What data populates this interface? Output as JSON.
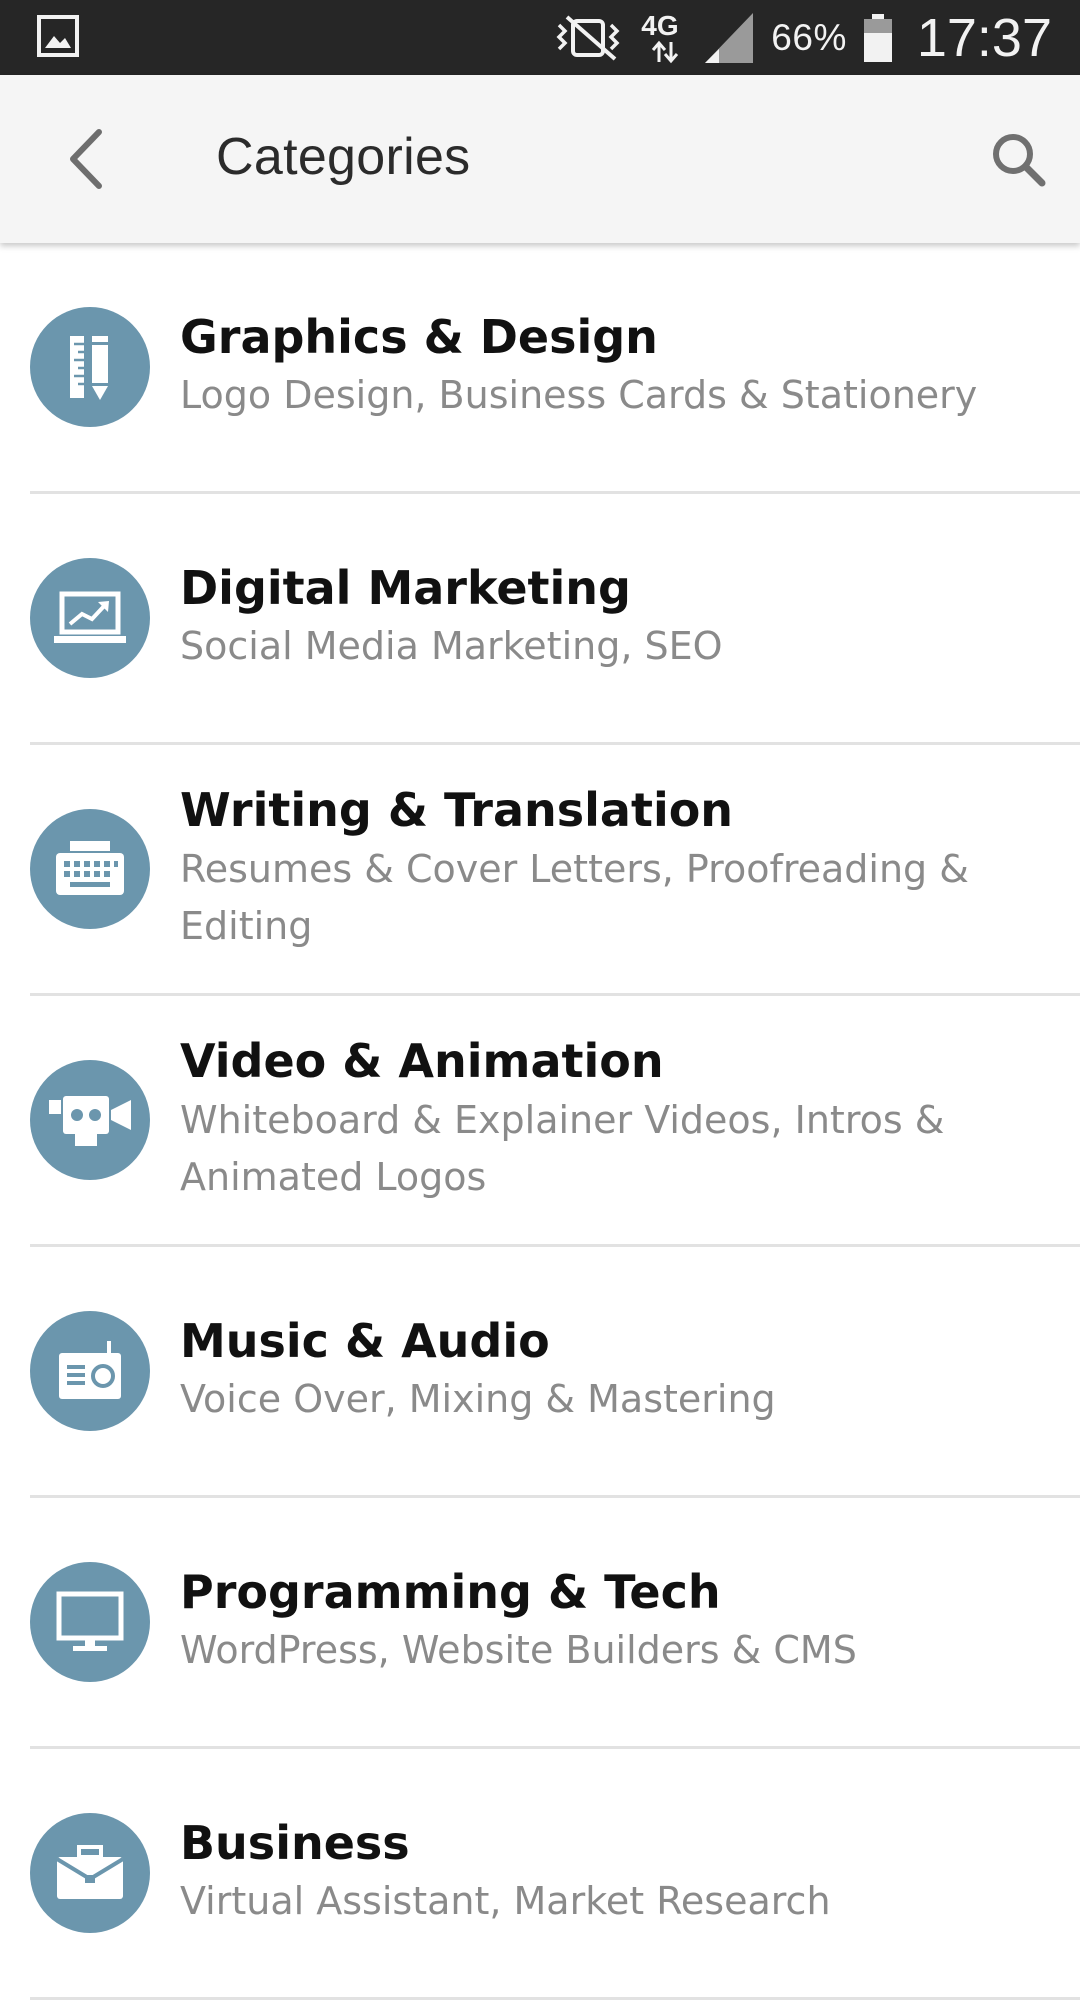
{
  "status_bar": {
    "network": "4G",
    "battery_percent": "66%",
    "time": "17:37",
    "icons": [
      "image-icon",
      "vibrate-off-icon",
      "network-4g-icon",
      "signal-icon",
      "battery-icon"
    ]
  },
  "app_bar": {
    "title": "Categories",
    "back_icon": "chevron-left-icon",
    "search_icon": "search-icon"
  },
  "colors": {
    "icon_circle": "#6b96ad",
    "status_bar_bg": "#262626",
    "app_bar_bg": "#f5f5f5",
    "title_text": "#111111",
    "subtitle_text": "#8a8a8a"
  },
  "categories": [
    {
      "title": "Graphics & Design",
      "subtitle": "Logo Design, Business Cards & Stationery",
      "icon": "pencil-ruler-icon"
    },
    {
      "title": "Digital Marketing",
      "subtitle": "Social Media Marketing, SEO",
      "icon": "laptop-chart-icon"
    },
    {
      "title": "Writing & Translation",
      "subtitle": "Resumes & Cover Letters, Proofreading & Editing",
      "icon": "typewriter-icon"
    },
    {
      "title": "Video & Animation",
      "subtitle": "Whiteboard & Explainer Videos, Intros & Animated Logos",
      "icon": "video-camera-icon"
    },
    {
      "title": "Music & Audio",
      "subtitle": "Voice Over, Mixing & Mastering",
      "icon": "radio-icon"
    },
    {
      "title": "Programming & Tech",
      "subtitle": "WordPress, Website Builders & CMS",
      "icon": "monitor-icon"
    },
    {
      "title": "Business",
      "subtitle": "Virtual Assistant, Market Research",
      "icon": "briefcase-icon"
    }
  ]
}
